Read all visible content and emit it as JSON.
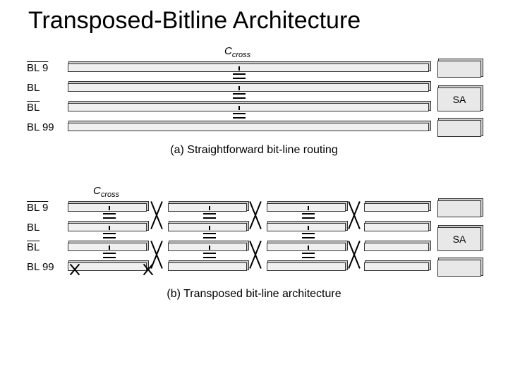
{
  "title": "Transposed-Bitline Architecture",
  "labels": {
    "bl9bar": "BL 9",
    "bl": "BL",
    "blbar": "BL",
    "bl99": "BL 99",
    "sa": "SA",
    "ccross": "C",
    "ccross_sub": "cross"
  },
  "captions": {
    "a": "(a) Straightforward bit-line routing",
    "b": "(b) Transposed bit-line architecture"
  }
}
